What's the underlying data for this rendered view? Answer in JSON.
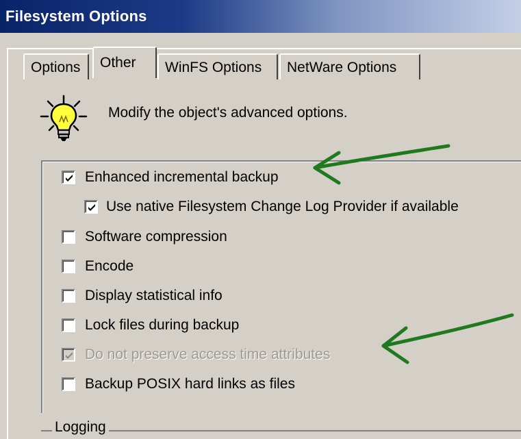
{
  "window": {
    "title": "Filesystem Options"
  },
  "tabs": [
    {
      "label": "Options"
    },
    {
      "label": "Other"
    },
    {
      "label": "WinFS Options"
    },
    {
      "label": "NetWare Options"
    }
  ],
  "header": {
    "text": "Modify the object's advanced options."
  },
  "options": [
    {
      "label": "Enhanced incremental backup",
      "checked": true,
      "enabled": true
    },
    {
      "label": "Use native Filesystem Change Log Provider if available",
      "checked": true,
      "enabled": true
    },
    {
      "label": "Software compression",
      "checked": false,
      "enabled": true
    },
    {
      "label": "Encode",
      "checked": false,
      "enabled": true
    },
    {
      "label": "Display statistical info",
      "checked": false,
      "enabled": true
    },
    {
      "label": "Lock files during backup",
      "checked": false,
      "enabled": true
    },
    {
      "label": "Do not preserve access time attributes",
      "checked": true,
      "enabled": false
    },
    {
      "label": "Backup POSIX hard links as files",
      "checked": false,
      "enabled": true
    }
  ],
  "logging": {
    "label": "Logging"
  },
  "colors": {
    "annotation_arrow": "#1f7a1f",
    "titlebar": "#0a246a"
  },
  "icons": {
    "header": "lightbulb-icon"
  }
}
